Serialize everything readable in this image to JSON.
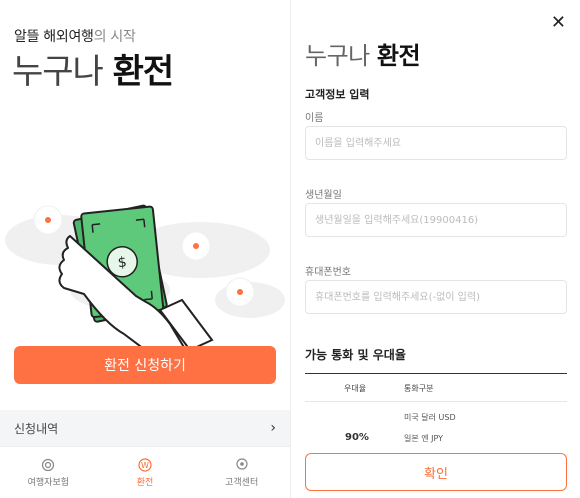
{
  "left": {
    "subtitle_bold": "알뜰 해외여행",
    "subtitle_light": "의 시작",
    "title_light": "누구나",
    "title_bold": "환전",
    "apply_button": "환전 신청하기",
    "history_label": "신청내역",
    "nav": [
      {
        "label": "여행자보험",
        "icon": "fingerprint-icon"
      },
      {
        "label": "환전",
        "icon": "won-coin-icon",
        "active": true
      },
      {
        "label": "고객센터",
        "icon": "location-pin-icon"
      }
    ]
  },
  "right": {
    "title_light": "누구나",
    "title_bold": "환전",
    "section_customer": "고객정보 입력",
    "name_label": "이름",
    "name_placeholder": "이름을 입력해주세요",
    "birth_label": "생년월일",
    "birth_placeholder": "생년월일을 입력해주세요(19900416)",
    "phone_label": "휴대폰번호",
    "phone_placeholder": "휴대폰번호를 입력해주세요(-없이 입력)",
    "table_title": "가능 통화 및 우대율",
    "col_rate": "우대율",
    "col_currency": "통화구분",
    "rows": [
      {
        "rate": "90%",
        "currencies": [
          "미국 달러 USD",
          "일본 엔 JPY"
        ]
      }
    ],
    "confirm_button": "확인"
  },
  "colors": {
    "accent": "#ff7043",
    "note_green": "#5ec97a"
  }
}
